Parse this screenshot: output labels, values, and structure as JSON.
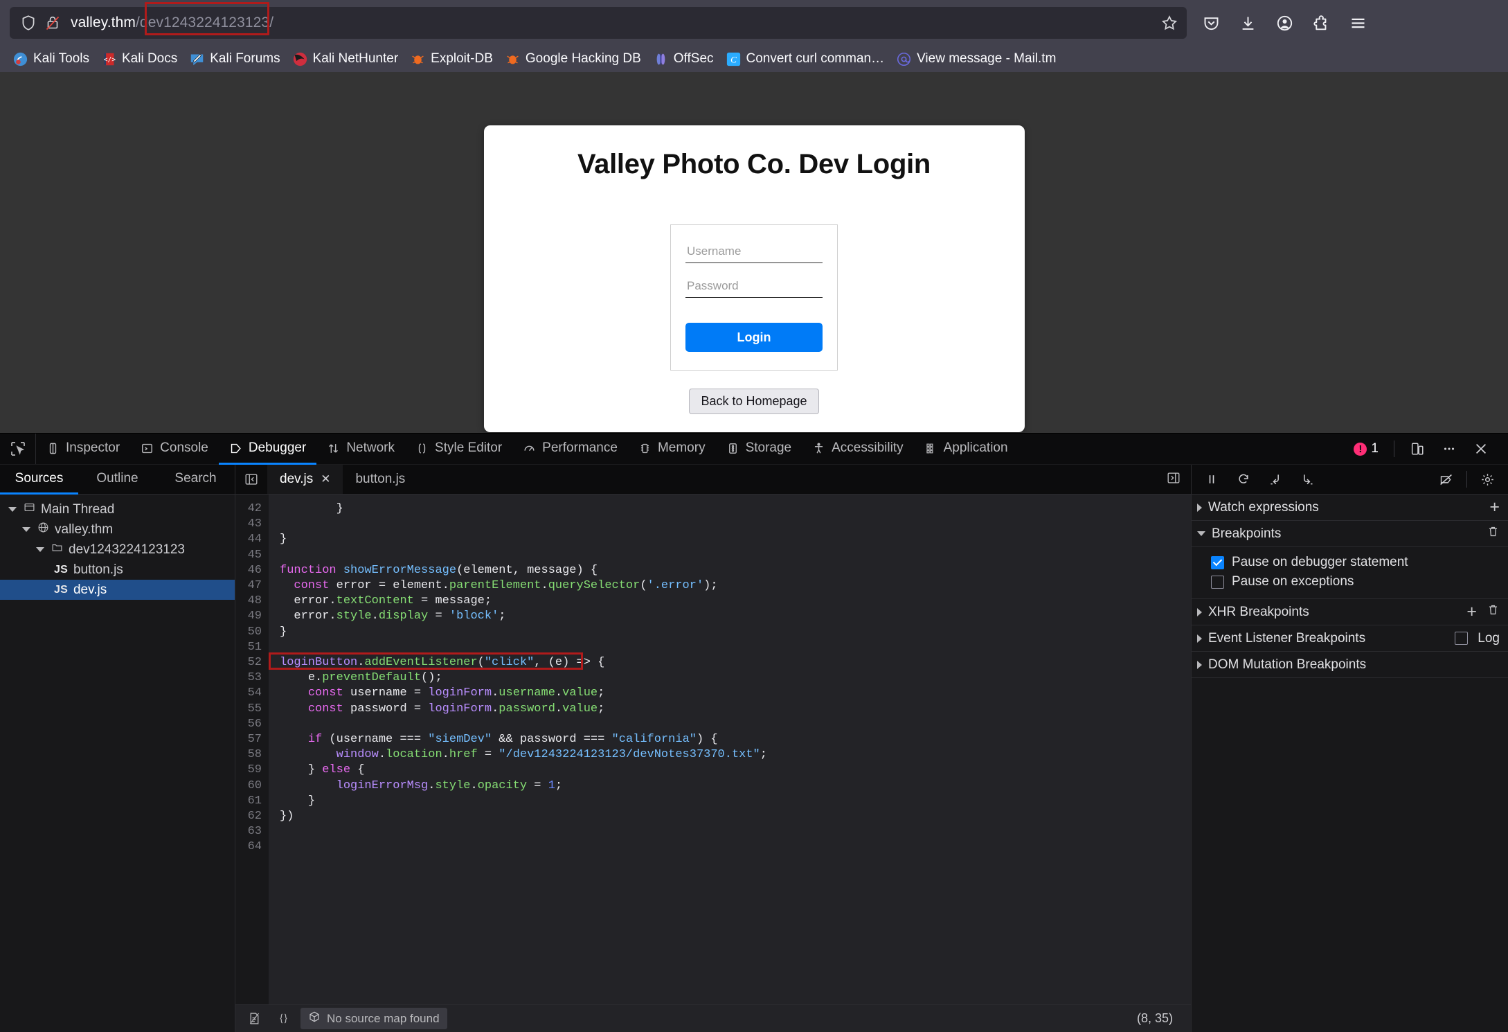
{
  "browser": {
    "url_host": "valley.thm",
    "url_path": "/dev1243224123123/",
    "icons": {
      "shield": "shield-icon",
      "lock": "lock-crossed-icon",
      "bookmark_star": "bookmark-star-icon",
      "pocket": "pocket-icon",
      "downloads": "downloads-icon",
      "account": "account-icon",
      "extensions": "extensions-icon",
      "menu": "hamburger-menu-icon"
    },
    "bookmarks": [
      {
        "label": "Kali Tools",
        "icon": "kali-tools-icon"
      },
      {
        "label": "Kali Docs",
        "icon": "kali-docs-icon"
      },
      {
        "label": "Kali Forums",
        "icon": "kali-forums-icon"
      },
      {
        "label": "Kali NetHunter",
        "icon": "kali-nethunter-icon"
      },
      {
        "label": "Exploit-DB",
        "icon": "exploit-db-icon"
      },
      {
        "label": "Google Hacking DB",
        "icon": "google-hacking-db-icon"
      },
      {
        "label": "OffSec",
        "icon": "offsec-icon"
      },
      {
        "label": "Convert curl comman…",
        "icon": "curl-converter-icon"
      },
      {
        "label": "View message - Mail.tm",
        "icon": "mail-tm-icon"
      }
    ]
  },
  "page": {
    "title": "Valley Photo Co. Dev Login",
    "username_placeholder": "Username",
    "username_value": "",
    "password_placeholder": "Password",
    "password_value": "",
    "login_label": "Login",
    "home_label": "Back to Homepage",
    "accent_color": "#007bf7"
  },
  "devtools": {
    "tabs": [
      {
        "label": "Inspector",
        "icon": "inspector-icon",
        "active": false
      },
      {
        "label": "Console",
        "icon": "console-icon",
        "active": false
      },
      {
        "label": "Debugger",
        "icon": "debugger-icon",
        "active": true
      },
      {
        "label": "Network",
        "icon": "network-icon",
        "active": false
      },
      {
        "label": "Style Editor",
        "icon": "style-editor-icon",
        "active": false
      },
      {
        "label": "Performance",
        "icon": "performance-icon",
        "active": false
      },
      {
        "label": "Memory",
        "icon": "memory-icon",
        "active": false
      },
      {
        "label": "Storage",
        "icon": "storage-icon",
        "active": false
      },
      {
        "label": "Accessibility",
        "icon": "accessibility-icon",
        "active": false
      },
      {
        "label": "Application",
        "icon": "application-icon",
        "active": false
      }
    ],
    "error_count": "1",
    "picker_icon": "element-picker-icon",
    "responsive_icon": "responsive-design-mode-icon",
    "meatball_icon": "more-options-icon",
    "close_icon": "close-devtools-icon",
    "sources": {
      "tabs": [
        {
          "label": "Sources",
          "active": true
        },
        {
          "label": "Outline",
          "active": false
        },
        {
          "label": "Search",
          "active": false
        }
      ],
      "tree": [
        {
          "label": "Main Thread",
          "depth": 0,
          "icon": "thread-icon",
          "twisty": "down",
          "selected": false
        },
        {
          "label": "valley.thm",
          "depth": 1,
          "icon": "globe-icon",
          "twisty": "down",
          "selected": false
        },
        {
          "label": "dev1243224123123",
          "depth": 2,
          "icon": "folder-icon",
          "twisty": "down",
          "selected": false
        },
        {
          "label": "button.js",
          "depth": 3,
          "icon": "js-icon",
          "twisty": "none",
          "selected": false
        },
        {
          "label": "dev.js",
          "depth": 3,
          "icon": "js-icon",
          "twisty": "none",
          "selected": true
        }
      ]
    },
    "editor": {
      "tabs": [
        {
          "label": "dev.js",
          "active": true,
          "closable": true
        },
        {
          "label": "button.js",
          "active": false,
          "closable": false
        }
      ],
      "first_line_number": 42,
      "lines": [
        "        }",
        "",
        "}",
        "",
        "function showErrorMessage(element, message) {",
        "  const error = element.parentElement.querySelector('.error');",
        "  error.textContent = message;",
        "  error.style.display = 'block';",
        "}",
        "",
        "loginButton.addEventListener(\"click\", (e) => {",
        "    e.preventDefault();",
        "    const username = loginForm.username.value;",
        "    const password = loginForm.password.value;",
        "",
        "    if (username === \"siemDev\" && password === \"california\") {",
        "        window.location.href = \"/dev1243224123123/devNotes37370.txt\";",
        "    } else {",
        "        loginErrorMsg.style.opacity = 1;",
        "    }",
        "})",
        "",
        ""
      ],
      "highlighted_line": 57,
      "highlight_color": "#b01b1b",
      "status": {
        "prettyprint_icon": "pretty-print-icon",
        "braces_icon": "source-map-braces-icon",
        "source_map_label": "No source map found",
        "source_map_icon": "package-icon",
        "cursor_position": "(8, 35)"
      }
    },
    "debugger_panel": {
      "controls": [
        {
          "name": "pause-resume-button",
          "icon": "pause-icon"
        },
        {
          "name": "step-over-button",
          "icon": "step-over-icon"
        },
        {
          "name": "step-in-button",
          "icon": "step-in-icon"
        },
        {
          "name": "step-out-button",
          "icon": "step-out-icon"
        },
        {
          "name": "deactivate-breakpoints-button",
          "icon": "breakpoints-off-icon"
        },
        {
          "name": "debugger-settings-button",
          "icon": "gear-icon"
        }
      ],
      "sections": [
        {
          "label": "Watch expressions",
          "expanded": false,
          "action": "+"
        },
        {
          "label": "Breakpoints",
          "expanded": true,
          "action": "trash"
        },
        {
          "label": "XHR Breakpoints",
          "expanded": false,
          "action": "+trash"
        },
        {
          "label": "Event Listener Breakpoints",
          "expanded": false,
          "action": "log"
        },
        {
          "label": "DOM Mutation Breakpoints",
          "expanded": false,
          "action": "none"
        }
      ],
      "breakpoint_options": [
        {
          "label": "Pause on debugger statement",
          "checked": true
        },
        {
          "label": "Pause on exceptions",
          "checked": false
        }
      ],
      "log_label": "Log"
    }
  }
}
